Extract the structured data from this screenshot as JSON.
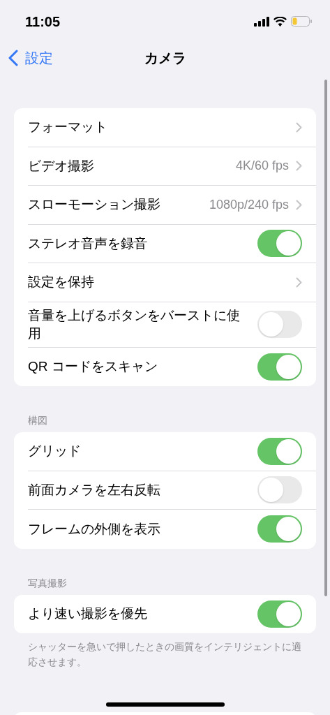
{
  "status_bar": {
    "time": "11:05"
  },
  "nav_bar": {
    "back": "設定",
    "title": "カメラ"
  },
  "sections": [
    {
      "rows": [
        {
          "kind": "link",
          "label": "フォーマット"
        },
        {
          "kind": "link",
          "label": "ビデオ撮影",
          "value": "4K/60 fps"
        },
        {
          "kind": "link",
          "label": "スローモーション撮影",
          "value": "1080p/240 fps"
        },
        {
          "kind": "toggle",
          "label": "ステレオ音声を録音",
          "on": true
        },
        {
          "kind": "link",
          "label": "設定を保持"
        },
        {
          "kind": "toggle",
          "label": "音量を上げるボタンをバーストに使用",
          "on": false
        },
        {
          "kind": "toggle",
          "label": "QR コードをスキャン",
          "on": true
        }
      ]
    },
    {
      "header": "構図",
      "rows": [
        {
          "kind": "toggle",
          "label": "グリッド",
          "on": true
        },
        {
          "kind": "toggle",
          "label": "前面カメラを左右反転",
          "on": false
        },
        {
          "kind": "toggle",
          "label": "フレームの外側を表示",
          "on": true
        }
      ]
    },
    {
      "header": "写真撮影",
      "rows": [
        {
          "kind": "toggle",
          "label": "より速い撮影を優先",
          "on": true
        }
      ],
      "footer": "シャッターを急いで押したときの画質をインテリジェントに適応させます。"
    }
  ]
}
